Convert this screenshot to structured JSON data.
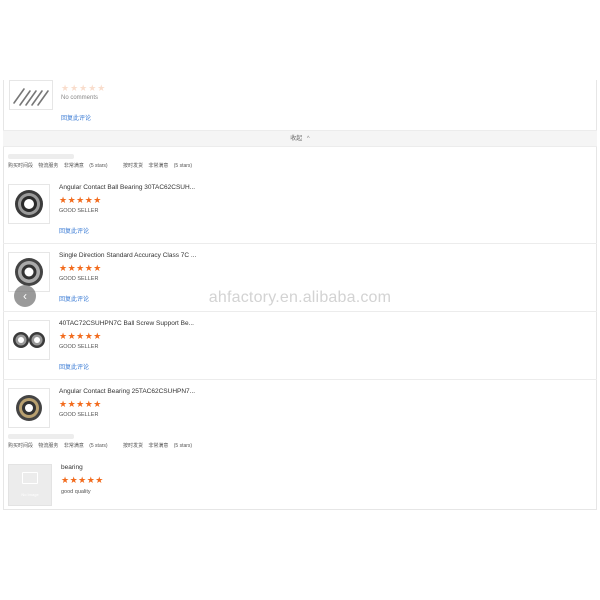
{
  "top_review": {
    "stars": "★★★★★",
    "comment": "No comments",
    "reply_link": "回复此评论"
  },
  "collapse_bar": {
    "label": "收起",
    "chevron": "^"
  },
  "meta_row_1": {
    "purchase_date": "购买时间段",
    "logistics_label": "物流服务",
    "logistics_value": "非常满意",
    "logistics_stars": "(5 stars)",
    "seller_label": "按时发货",
    "seller_value": "非常满意",
    "seller_stars": "(5 stars)"
  },
  "products": [
    {
      "title": "Angular Contact Ball Bearing 30TAC62CSUH...",
      "stars": "★★★★★",
      "seller_rating": "GOOD SELLER",
      "reply_link": "回复此评论",
      "image_icon": "bearing-single-icon"
    },
    {
      "title": "Single Direction Standard Accuracy Class 7C ...",
      "stars": "★★★★★",
      "seller_rating": "GOOD SELLER",
      "reply_link": "回复此评论",
      "image_icon": "bearing-single-icon"
    },
    {
      "title": "40TAC72CSUHPN7C Ball Screw Support Be...",
      "stars": "★★★★★",
      "seller_rating": "GOOD SELLER",
      "reply_link": "回复此评论",
      "image_icon": "bearing-pair-icon"
    },
    {
      "title": "Angular Contact Bearing 25TAC62CSUHPN7...",
      "stars": "★★★★★",
      "seller_rating": "GOOD SELLER",
      "reply_link": "",
      "image_icon": "bearing-single-icon"
    }
  ],
  "meta_row_2": {
    "purchase_date": "购买时间段",
    "logistics_label": "物流服务",
    "logistics_value": "非常满意",
    "logistics_stars": "(5 stars)",
    "seller_label": "按时发货",
    "seller_value": "非常满意",
    "seller_stars": "(5 stars)"
  },
  "last_review": {
    "title": "bearing",
    "stars": "★★★★★",
    "comment": "good quality",
    "placeholder_label": "No Image"
  },
  "watermark": "ahfactory.en.alibaba.com",
  "carousel": {
    "prev_label": "‹"
  },
  "colors": {
    "star": "#f26b1d",
    "link": "#3a7bd5",
    "border": "#e6e6e6"
  }
}
